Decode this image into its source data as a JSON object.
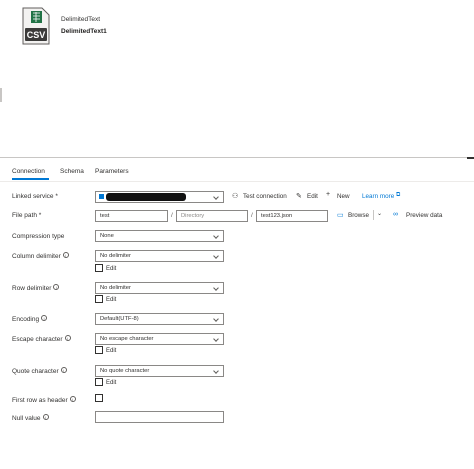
{
  "dataset": {
    "type": "DelimitedText",
    "name": "DelimitedText1",
    "icon_text": "CSV"
  },
  "tabs": [
    {
      "label": "Connection"
    },
    {
      "label": "Schema"
    },
    {
      "label": "Parameters"
    }
  ],
  "connection": {
    "linked_service": {
      "label": "Linked service *",
      "value": "",
      "test_connection": "Test connection",
      "edit": "Edit",
      "new": "New",
      "learn_more": "Learn more"
    },
    "file_path": {
      "label": "File path *",
      "container": "test",
      "directory_placeholder": "Directory",
      "file": "test123.json",
      "browse": "Browse",
      "preview": "Preview data",
      "separator": "/"
    },
    "compression_type": {
      "label": "Compression type",
      "value": "None"
    },
    "column_delimiter": {
      "label": "Column delimiter",
      "value": "No delimiter",
      "edit": "Edit"
    },
    "row_delimiter": {
      "label": "Row delimiter",
      "value": "No delimiter",
      "edit": "Edit"
    },
    "encoding": {
      "label": "Encoding",
      "value": "Default(UTF-8)"
    },
    "escape_character": {
      "label": "Escape character",
      "value": "No escape character",
      "edit": "Edit"
    },
    "quote_character": {
      "label": "Quote character",
      "value": "No quote character",
      "edit": "Edit"
    },
    "first_row_header": {
      "label": "First row as header"
    },
    "null_value": {
      "label": "Null value",
      "value": ""
    }
  },
  "colors": {
    "accent": "#0078d4",
    "excel_green": "#217346",
    "border": "#8a8886"
  },
  "icons": [
    "csv-file-icon",
    "test-connection-icon",
    "edit-icon",
    "add-icon",
    "external-link-icon",
    "folder-icon",
    "chevron-down-icon",
    "preview-icon",
    "info-icon"
  ]
}
